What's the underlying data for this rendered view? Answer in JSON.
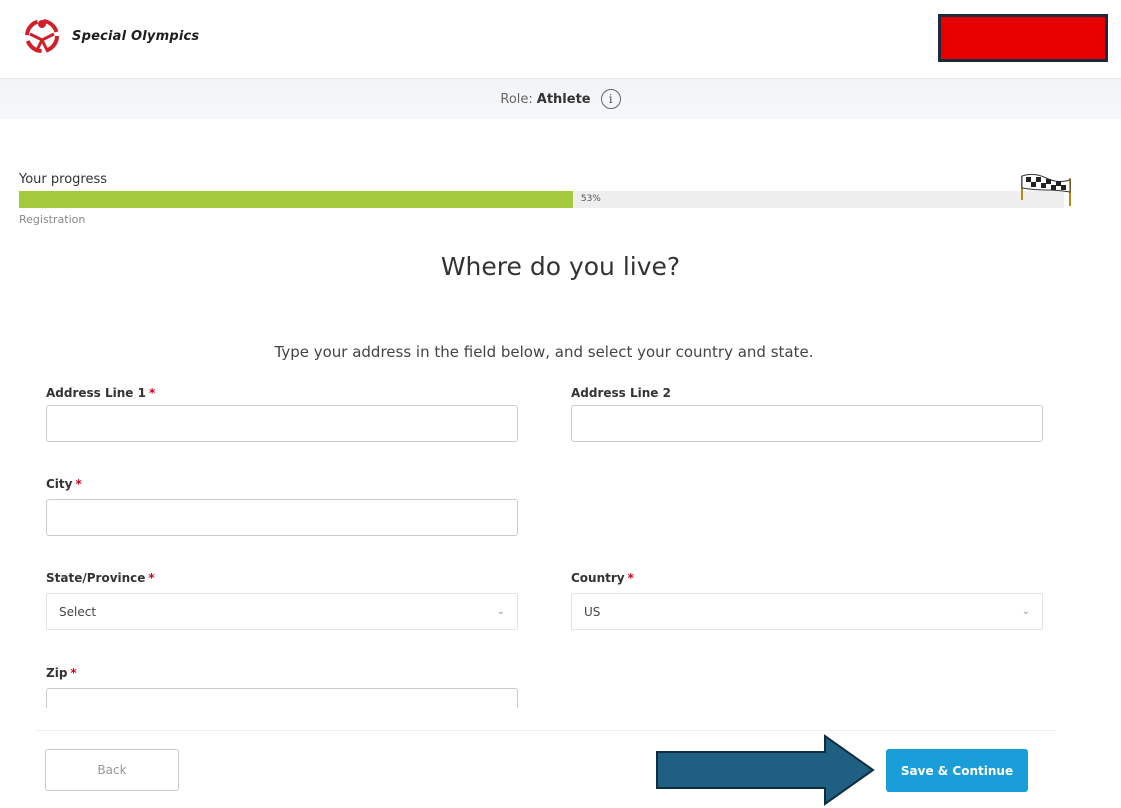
{
  "header": {
    "logo_text": "Special Olympics"
  },
  "role_bar": {
    "label": "Role:",
    "value": "Athlete",
    "info_icon": "info-icon"
  },
  "progress": {
    "label": "Your progress",
    "percent": 53,
    "percent_text": "53%",
    "step": "Registration",
    "finish_icon": "checkered-flag-icon"
  },
  "page": {
    "title": "Where do you live?",
    "subtitle": "Type your address in the field below, and select your country and state."
  },
  "form": {
    "address_line_1": {
      "label": "Address Line 1",
      "required_mark": "*",
      "value": ""
    },
    "address_line_2": {
      "label": "Address Line 2",
      "value": ""
    },
    "city": {
      "label": "City",
      "required_mark": "*",
      "value": ""
    },
    "state": {
      "label": "State/Province",
      "required_mark": "*",
      "selected": "Select"
    },
    "country": {
      "label": "Country",
      "required_mark": "*",
      "selected": "US"
    },
    "zip": {
      "label": "Zip",
      "required_mark": "*",
      "value": ""
    }
  },
  "footer": {
    "back_label": "Back",
    "save_label": "Save & Continue"
  },
  "colors": {
    "accent": "#1a9ed9",
    "progress_fill": "#a5c93c",
    "required": "#d0021b",
    "redaction_box": "#e60000",
    "annotation_arrow": "#1f5f82"
  }
}
